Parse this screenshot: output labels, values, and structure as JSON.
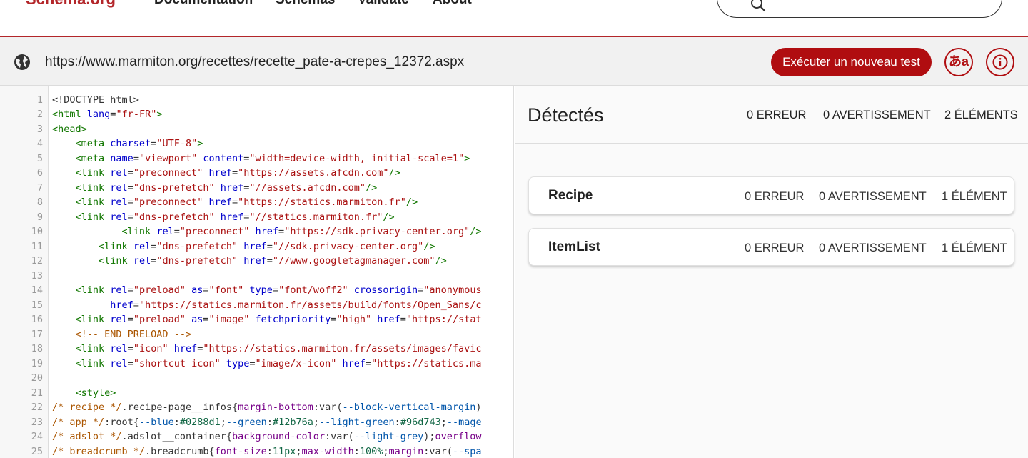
{
  "nav": {
    "logo": "Schema.org",
    "links": [
      "Documentation",
      "Schemas",
      "Validate",
      "About"
    ]
  },
  "urlbar": {
    "url": "https://www.marmiton.org/recettes/recette_pate-a-crepes_12372.aspx",
    "run_button": "Exécuter un nouveau test",
    "lang_button": "あa"
  },
  "results": {
    "title": "Détectés",
    "errors": "0 ERREUR",
    "warnings": "0 AVERTISSEMENT",
    "items": "2 ÉLÉMENTS",
    "types": [
      {
        "name": "Recipe",
        "errors": "0 ERREUR",
        "warnings": "0 AVERTISSEMENT",
        "items": "1 ÉLÉMENT"
      },
      {
        "name": "ItemList",
        "errors": "0 ERREUR",
        "warnings": "0 AVERTISSEMENT",
        "items": "1 ÉLÉMENT"
      }
    ]
  },
  "code": {
    "lines": [
      [
        [
          "plain",
          "<!DOCTYPE html>"
        ]
      ],
      [
        [
          "tag",
          "<html "
        ],
        [
          "attr",
          "lang"
        ],
        [
          "plain",
          "="
        ],
        [
          "str",
          "\"fr-FR\""
        ],
        [
          "tag",
          ">"
        ]
      ],
      [
        [
          "tag",
          "<head>"
        ]
      ],
      [
        [
          "plain",
          "    "
        ],
        [
          "tag",
          "<meta "
        ],
        [
          "attr",
          "charset"
        ],
        [
          "plain",
          "="
        ],
        [
          "str",
          "\"UTF-8\""
        ],
        [
          "tag",
          ">"
        ]
      ],
      [
        [
          "plain",
          "    "
        ],
        [
          "tag",
          "<meta "
        ],
        [
          "attr",
          "name"
        ],
        [
          "plain",
          "="
        ],
        [
          "str",
          "\"viewport\" "
        ],
        [
          "attr",
          "content"
        ],
        [
          "plain",
          "="
        ],
        [
          "str",
          "\"width=device-width, initial-scale=1\""
        ],
        [
          "tag",
          ">"
        ]
      ],
      [
        [
          "plain",
          "    "
        ],
        [
          "tag",
          "<link "
        ],
        [
          "attr",
          "rel"
        ],
        [
          "plain",
          "="
        ],
        [
          "str",
          "\"preconnect\" "
        ],
        [
          "attr",
          "href"
        ],
        [
          "plain",
          "="
        ],
        [
          "str",
          "\"https://assets.afcdn.com\""
        ],
        [
          "tag",
          "/>"
        ]
      ],
      [
        [
          "plain",
          "    "
        ],
        [
          "tag",
          "<link "
        ],
        [
          "attr",
          "rel"
        ],
        [
          "plain",
          "="
        ],
        [
          "str",
          "\"dns-prefetch\" "
        ],
        [
          "attr",
          "href"
        ],
        [
          "plain",
          "="
        ],
        [
          "str",
          "\"//assets.afcdn.com\""
        ],
        [
          "tag",
          "/>"
        ]
      ],
      [
        [
          "plain",
          "    "
        ],
        [
          "tag",
          "<link "
        ],
        [
          "attr",
          "rel"
        ],
        [
          "plain",
          "="
        ],
        [
          "str",
          "\"preconnect\" "
        ],
        [
          "attr",
          "href"
        ],
        [
          "plain",
          "="
        ],
        [
          "str",
          "\"https://statics.marmiton.fr\""
        ],
        [
          "tag",
          "/>"
        ]
      ],
      [
        [
          "plain",
          "    "
        ],
        [
          "tag",
          "<link "
        ],
        [
          "attr",
          "rel"
        ],
        [
          "plain",
          "="
        ],
        [
          "str",
          "\"dns-prefetch\" "
        ],
        [
          "attr",
          "href"
        ],
        [
          "plain",
          "="
        ],
        [
          "str",
          "\"//statics.marmiton.fr\""
        ],
        [
          "tag",
          "/>"
        ]
      ],
      [
        [
          "plain",
          "            "
        ],
        [
          "tag",
          "<link "
        ],
        [
          "attr",
          "rel"
        ],
        [
          "plain",
          "="
        ],
        [
          "str",
          "\"preconnect\" "
        ],
        [
          "attr",
          "href"
        ],
        [
          "plain",
          "="
        ],
        [
          "str",
          "\"https://sdk.privacy-center.org\""
        ],
        [
          "tag",
          "/>"
        ]
      ],
      [
        [
          "plain",
          "        "
        ],
        [
          "tag",
          "<link "
        ],
        [
          "attr",
          "rel"
        ],
        [
          "plain",
          "="
        ],
        [
          "str",
          "\"dns-prefetch\" "
        ],
        [
          "attr",
          "href"
        ],
        [
          "plain",
          "="
        ],
        [
          "str",
          "\"//sdk.privacy-center.org\""
        ],
        [
          "tag",
          "/>"
        ]
      ],
      [
        [
          "plain",
          "        "
        ],
        [
          "tag",
          "<link "
        ],
        [
          "attr",
          "rel"
        ],
        [
          "plain",
          "="
        ],
        [
          "str",
          "\"dns-prefetch\" "
        ],
        [
          "attr",
          "href"
        ],
        [
          "plain",
          "="
        ],
        [
          "str",
          "\"//www.googletagmanager.com\""
        ],
        [
          "tag",
          "/>"
        ]
      ],
      [
        [
          "plain",
          ""
        ]
      ],
      [
        [
          "plain",
          "    "
        ],
        [
          "tag",
          "<link "
        ],
        [
          "attr",
          "rel"
        ],
        [
          "plain",
          "="
        ],
        [
          "str",
          "\"preload\" "
        ],
        [
          "attr",
          "as"
        ],
        [
          "plain",
          "="
        ],
        [
          "str",
          "\"font\" "
        ],
        [
          "attr",
          "type"
        ],
        [
          "plain",
          "="
        ],
        [
          "str",
          "\"font/woff2\" "
        ],
        [
          "attr",
          "crossorigin"
        ],
        [
          "plain",
          "="
        ],
        [
          "str",
          "\"anonymous"
        ]
      ],
      [
        [
          "plain",
          "          "
        ],
        [
          "attr",
          "href"
        ],
        [
          "plain",
          "="
        ],
        [
          "str",
          "\"https://statics.marmiton.fr/assets/build/fonts/Open_Sans/c"
        ]
      ],
      [
        [
          "plain",
          "    "
        ],
        [
          "tag",
          "<link "
        ],
        [
          "attr",
          "rel"
        ],
        [
          "plain",
          "="
        ],
        [
          "str",
          "\"preload\" "
        ],
        [
          "attr",
          "as"
        ],
        [
          "plain",
          "="
        ],
        [
          "str",
          "\"image\" "
        ],
        [
          "attr",
          "fetchpriority"
        ],
        [
          "plain",
          "="
        ],
        [
          "str",
          "\"high\" "
        ],
        [
          "attr",
          "href"
        ],
        [
          "plain",
          "="
        ],
        [
          "str",
          "\"https://stat"
        ]
      ],
      [
        [
          "plain",
          "    "
        ],
        [
          "cmt",
          "<!-- END PRELOAD -->"
        ]
      ],
      [
        [
          "plain",
          "    "
        ],
        [
          "tag",
          "<link "
        ],
        [
          "attr",
          "rel"
        ],
        [
          "plain",
          "="
        ],
        [
          "str",
          "\"icon\" "
        ],
        [
          "attr",
          "href"
        ],
        [
          "plain",
          "="
        ],
        [
          "str",
          "\"https://statics.marmiton.fr/assets/images/favic"
        ]
      ],
      [
        [
          "plain",
          "    "
        ],
        [
          "tag",
          "<link "
        ],
        [
          "attr",
          "rel"
        ],
        [
          "plain",
          "="
        ],
        [
          "str",
          "\"shortcut icon\" "
        ],
        [
          "attr",
          "type"
        ],
        [
          "plain",
          "="
        ],
        [
          "str",
          "\"image/x-icon\" "
        ],
        [
          "attr",
          "href"
        ],
        [
          "plain",
          "="
        ],
        [
          "str",
          "\"https://statics.ma"
        ]
      ],
      [
        [
          "plain",
          ""
        ]
      ],
      [
        [
          "plain",
          "    "
        ],
        [
          "tag",
          "<style>"
        ]
      ],
      [
        [
          "cmt",
          "/* recipe */"
        ],
        [
          "plain",
          "."
        ],
        [
          "plain",
          "recipe-page__infos"
        ],
        [
          "plain",
          "{"
        ],
        [
          "kw",
          "margin-bottom"
        ],
        [
          "plain",
          ":"
        ],
        [
          "plain",
          "var("
        ],
        [
          "var",
          "--block-vertical-margin"
        ],
        [
          "plain",
          ")"
        ]
      ],
      [
        [
          "cmt",
          "/* app */"
        ],
        [
          "plain",
          ":root{"
        ],
        [
          "var",
          "--blue"
        ],
        [
          "plain",
          ":"
        ],
        [
          "num",
          "#0288d1"
        ],
        [
          "plain",
          ";"
        ],
        [
          "var",
          "--green"
        ],
        [
          "plain",
          ":"
        ],
        [
          "num",
          "#12b76a"
        ],
        [
          "plain",
          ";"
        ],
        [
          "var",
          "--light-green"
        ],
        [
          "plain",
          ":"
        ],
        [
          "num",
          "#96d743"
        ],
        [
          "plain",
          ";"
        ],
        [
          "var",
          "--mage"
        ]
      ],
      [
        [
          "cmt",
          "/* adslot */"
        ],
        [
          "plain",
          ".adslot__container{"
        ],
        [
          "kw",
          "background-color"
        ],
        [
          "plain",
          ":var("
        ],
        [
          "var",
          "--light-grey"
        ],
        [
          "plain",
          ");"
        ],
        [
          "kw",
          "overflow"
        ]
      ],
      [
        [
          "cmt",
          "/* breadcrumb */"
        ],
        [
          "plain",
          ".breadcrumb{"
        ],
        [
          "kw",
          "font-size"
        ],
        [
          "plain",
          ":"
        ],
        [
          "num",
          "11px"
        ],
        [
          "plain",
          ";"
        ],
        [
          "kw",
          "max-width"
        ],
        [
          "plain",
          ":"
        ],
        [
          "num",
          "100%"
        ],
        [
          "plain",
          ";"
        ],
        [
          "kw",
          "margin"
        ],
        [
          "plain",
          ":var("
        ],
        [
          "var",
          "--spa"
        ]
      ]
    ]
  }
}
